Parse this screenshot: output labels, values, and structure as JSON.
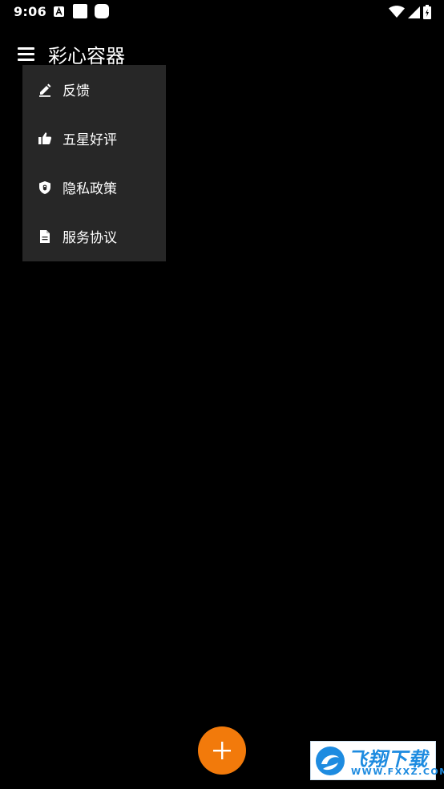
{
  "status_bar": {
    "time": "9:06",
    "icons": [
      "a-notification-icon",
      "square-notification-icon",
      "rounded-square-notification-icon",
      "wifi-icon",
      "signal-icon",
      "battery-icon"
    ]
  },
  "app_bar": {
    "title": "彩心容器",
    "menu_icon": "hamburger-menu-icon"
  },
  "popup_menu": {
    "items": [
      {
        "label": "反馈",
        "icon": "edit-pencil-icon"
      },
      {
        "label": "五星好评",
        "icon": "thumb-up-icon"
      },
      {
        "label": "隐私政策",
        "icon": "shield-lock-icon"
      },
      {
        "label": "服务协议",
        "icon": "document-icon"
      }
    ]
  },
  "fab": {
    "icon": "plus-icon",
    "color": "#f27a0b"
  },
  "watermark": {
    "main_text": "飞翔下载",
    "sub_text": "WWW.FXXZ.COM"
  }
}
